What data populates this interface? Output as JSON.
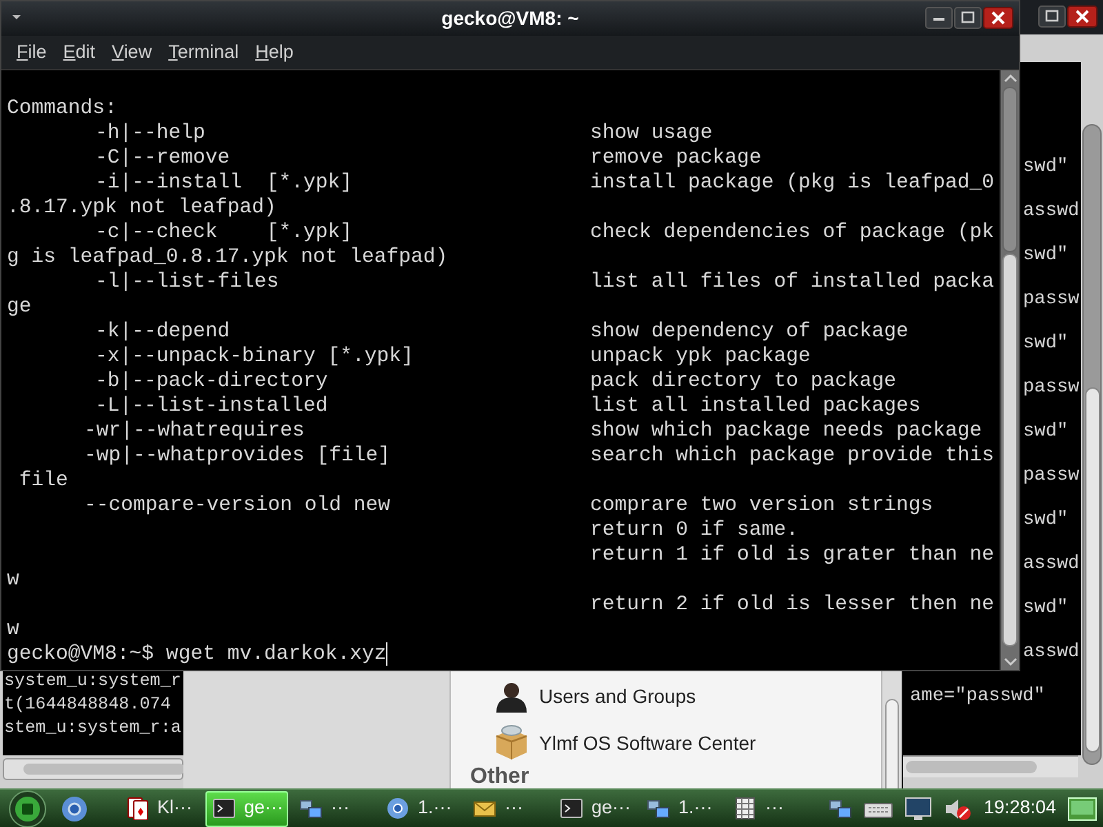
{
  "terminal_window": {
    "title": "gecko@VM8: ~",
    "menu": [
      "File",
      "Edit",
      "View",
      "Terminal",
      "Help"
    ],
    "lines": [
      {
        "kind": "text",
        "text": "Commands:"
      },
      {
        "kind": "option",
        "option": "-h|--help",
        "description": "show usage"
      },
      {
        "kind": "option",
        "option": "-C|--remove",
        "description": "remove package"
      },
      {
        "kind": "option",
        "option": "-i|--install  [*.ypk]",
        "description": "install package (pkg is leafpad_0"
      },
      {
        "kind": "text",
        "text": ".8.17.ypk not leafpad)"
      },
      {
        "kind": "option",
        "option": "-c|--check    [*.ypk]",
        "description": "check dependencies of package (pk"
      },
      {
        "kind": "text",
        "text": "g is leafpad_0.8.17.ypk not leafpad)"
      },
      {
        "kind": "option",
        "option": "-l|--list-files",
        "description": "list all files of installed packa"
      },
      {
        "kind": "text",
        "text": "ge"
      },
      {
        "kind": "option",
        "option": "-k|--depend",
        "description": "show dependency of package"
      },
      {
        "kind": "option",
        "option": "-x|--unpack-binary [*.ypk]",
        "description": "unpack ypk package"
      },
      {
        "kind": "option",
        "option": "-b|--pack-directory",
        "description": "pack directory to package"
      },
      {
        "kind": "option",
        "option": "-L|--list-installed",
        "description": "list all installed packages"
      },
      {
        "kind": "option_wide",
        "option": "-wr|--whatrequires",
        "description": "show which package needs package"
      },
      {
        "kind": "option_wide",
        "option": "-wp|--whatprovides [file]",
        "description": "search which package provide this"
      },
      {
        "kind": "text",
        "text": " file"
      },
      {
        "kind": "option_wide",
        "option": "--compare-version old new",
        "description": "comprare two version strings"
      },
      {
        "kind": "description",
        "description": "return 0 if same."
      },
      {
        "kind": "description",
        "description": "return 1 if old is grater than ne"
      },
      {
        "kind": "text",
        "text": "w"
      },
      {
        "kind": "description",
        "description": "return 2 if old is lesser then ne"
      },
      {
        "kind": "text",
        "text": "w"
      },
      {
        "kind": "prompt",
        "text": "gecko@VM8:~$ wget mv.darkok.xyz"
      }
    ]
  },
  "back_terminal_right": {
    "lines": [
      {
        "kind": "partial",
        "text": "swd\""
      },
      {
        "kind": "partial",
        "text": "asswd"
      },
      {
        "kind": "partial",
        "text": "swd\""
      },
      {
        "kind": "partial",
        "text": "passw"
      },
      {
        "kind": "partial",
        "text": "swd\""
      },
      {
        "kind": "partial",
        "text": "passw"
      },
      {
        "kind": "partial",
        "text": "swd\""
      },
      {
        "kind": "partial",
        "text": "passw"
      },
      {
        "kind": "partial",
        "text": "swd\""
      },
      {
        "kind": "partial",
        "text": "asswd"
      },
      {
        "kind": "partial",
        "text": "swd\""
      },
      {
        "kind": "partial",
        "text": "asswd"
      },
      {
        "kind": "full",
        "text": "ame=\"passwd\""
      }
    ]
  },
  "back_terminal_left": {
    "lines": [
      "system_u:system_r",
      "t(1644848848.074",
      "stem_u:system_r:a"
    ]
  },
  "settings_window": {
    "items": [
      {
        "kind": "user_item",
        "label": "Users and Groups"
      },
      {
        "kind": "package_item",
        "label": "Ylmf OS Software Center"
      },
      {
        "kind": "heading",
        "label": "Other"
      }
    ]
  },
  "taskbar": {
    "items": [
      {
        "kind": "cards",
        "label": "Kl···",
        "selected": false
      },
      {
        "kind": "terminal",
        "label": "ge···",
        "selected": true
      },
      {
        "kind": "network",
        "label": "···",
        "selected": false
      },
      {
        "kind": "browser",
        "label": "1.···",
        "selected": false
      },
      {
        "kind": "mail",
        "label": "···",
        "selected": false
      },
      {
        "kind": "terminal",
        "label": "ge···",
        "selected": false
      },
      {
        "kind": "network",
        "label": "1.···",
        "selected": false
      },
      {
        "kind": "calc",
        "label": "···",
        "selected": false
      }
    ],
    "clock": "19:28:04"
  }
}
